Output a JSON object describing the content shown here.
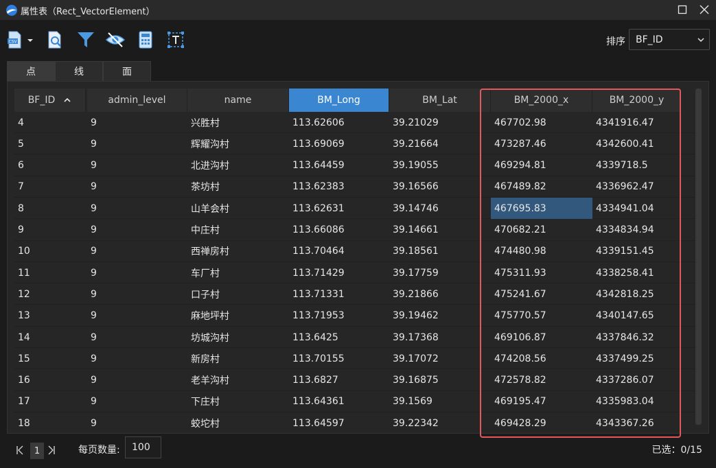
{
  "window": {
    "title": "属性表（Rect_VectorElement）"
  },
  "toolbar": {
    "icons": [
      "export-csv-icon",
      "search-document-icon",
      "filter-icon",
      "visibility-icon",
      "calculator-icon",
      "text-tool-icon"
    ],
    "sort_label": "排序",
    "sort_value": "BF_ID"
  },
  "tabs": [
    {
      "label": "点"
    },
    {
      "label": "线"
    },
    {
      "label": "面"
    }
  ],
  "table": {
    "columns": [
      "BF_ID",
      "admin_level",
      "name",
      "BM_Long",
      "BM_Lat",
      "BM_2000_x",
      "BM_2000_y"
    ],
    "rows": [
      [
        "4",
        "9",
        "兴胜村",
        "113.62606",
        "39.21029",
        "467702.98",
        "4341916.47"
      ],
      [
        "5",
        "9",
        "辉耀沟村",
        "113.69069",
        "39.21664",
        "473287.46",
        "4342600.41"
      ],
      [
        "6",
        "9",
        "北进沟村",
        "113.64459",
        "39.19055",
        "469294.81",
        "4339718.5"
      ],
      [
        "7",
        "9",
        "茶坊村",
        "113.62383",
        "39.16566",
        "467489.82",
        "4336962.47"
      ],
      [
        "8",
        "9",
        "山羊会村",
        "113.62631",
        "39.14746",
        "467695.83",
        "4334941.04"
      ],
      [
        "9",
        "9",
        "中庄村",
        "113.66086",
        "39.14661",
        "470682.21",
        "4334834.94"
      ],
      [
        "10",
        "9",
        "西禅房村",
        "113.70464",
        "39.18561",
        "474480.98",
        "4339151.45"
      ],
      [
        "11",
        "9",
        "车厂村",
        "113.71429",
        "39.17759",
        "475311.93",
        "4338258.41"
      ],
      [
        "12",
        "9",
        "口子村",
        "113.71331",
        "39.21866",
        "475241.67",
        "4342818.25"
      ],
      [
        "13",
        "9",
        "麻地坪村",
        "113.71953",
        "39.19462",
        "475770.57",
        "4340147.65"
      ],
      [
        "14",
        "9",
        "坊城沟村",
        "113.6425",
        "39.17368",
        "469106.87",
        "4337846.32"
      ],
      [
        "15",
        "9",
        "新房村",
        "113.70155",
        "39.17072",
        "474208.56",
        "4337499.25"
      ],
      [
        "16",
        "9",
        "老羊沟村",
        "113.6827",
        "39.16875",
        "472578.82",
        "4337286.07"
      ],
      [
        "17",
        "9",
        "下庄村",
        "113.64361",
        "39.1569",
        "469195.47",
        "4335983.04"
      ],
      [
        "18",
        "9",
        "蛟坨村",
        "113.64597",
        "39.22342",
        "469428.29",
        "4343367.26"
      ]
    ]
  },
  "footer": {
    "page": "1",
    "perpage_label": "每页数量:",
    "perpage_value": "100",
    "selected": "已选：0/15"
  },
  "colors": {
    "accent": "#3b86d0",
    "highlight": "#e4575c",
    "cell_selected": "#33587e"
  }
}
